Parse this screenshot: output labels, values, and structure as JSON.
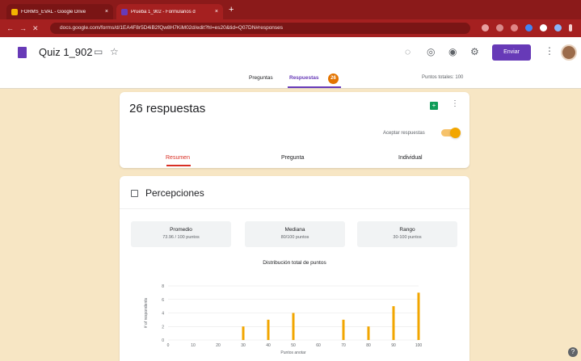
{
  "browser": {
    "tabs": [
      {
        "title": "FORMS_EVAL - Google Drive",
        "favicon_color": "#f4b400"
      },
      {
        "title": "Prueba 1_902 - Formularios d",
        "favicon_color": "#673ab7"
      }
    ],
    "new_tab": "+",
    "url": "docs.google.com/forms/d/1EA4F8r5D4iB2fQw8H7KiM02d/edit?hl=es20&tid=Q07DN#responses"
  },
  "app": {
    "title": "Quiz 1_902",
    "send_label": "Enviar",
    "tabs": {
      "preguntas": "Preguntas",
      "respuestas": "Respuestas",
      "badge": "26"
    },
    "points_total": "Puntos totales: 100"
  },
  "responses_card": {
    "count": "26 respuestas",
    "accept_label": "Aceptar respuestas",
    "tabs": [
      "Resumen",
      "Pregunta",
      "Individual"
    ]
  },
  "section": {
    "title": "Percepciones",
    "stats": [
      {
        "label": "Promedio",
        "value": "73.96 / 100 puntos"
      },
      {
        "label": "Mediana",
        "value": "80/100 puntos"
      },
      {
        "label": "Rango",
        "value": "30-100 puntos"
      }
    ]
  },
  "chart_data": {
    "type": "bar",
    "title": "Distribución total de puntos",
    "xlabel": "Puntos anotar",
    "ylabel": "# of respondents",
    "categories": [
      "0",
      "10",
      "20",
      "30",
      "40",
      "50",
      "60",
      "70",
      "80",
      "90",
      "100"
    ],
    "values": [
      0,
      0,
      0,
      2,
      3,
      4,
      0,
      3,
      2,
      5,
      7
    ],
    "ylim": [
      0,
      8
    ],
    "yticks": [
      0,
      2,
      4,
      6,
      8
    ],
    "bar_color": "#f2a600",
    "grid": true
  }
}
